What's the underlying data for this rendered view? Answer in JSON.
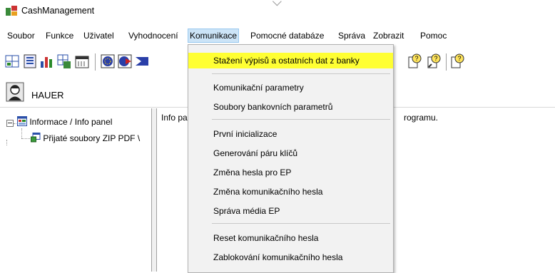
{
  "window": {
    "title": "CashManagement"
  },
  "menubar": {
    "items": [
      {
        "label": "Soubor"
      },
      {
        "label": "Funkce"
      },
      {
        "label": "Uživatel"
      },
      {
        "label": "Vyhodnocení"
      },
      {
        "label": "Komunikace"
      },
      {
        "label": "Pomocné databáze"
      },
      {
        "label": "Správa"
      },
      {
        "label": "Zobrazit"
      },
      {
        "label": "Pomoc"
      }
    ]
  },
  "user": {
    "name": "HAUER"
  },
  "tree": {
    "root": "Informace / Info panel",
    "child": "Přijaté soubory ZIP PDF \\"
  },
  "info_panel": {
    "left_fragment": "Info pa",
    "right_fragment": "rogramu."
  },
  "komunikace_menu": {
    "items": [
      {
        "label": "Stažení výpisů a ostatních dat z banky",
        "highlighted": true
      },
      {
        "label": "Komunikační parametry"
      },
      {
        "label": "Soubory bankovních parametrů"
      },
      {
        "label": "První inicializace"
      },
      {
        "label": "Generování páru klíčů"
      },
      {
        "label": "Změna hesla pro EP"
      },
      {
        "label": "Změna komunikačního hesla"
      },
      {
        "label": "Správa média EP"
      },
      {
        "label": "Reset komunikačního hesla"
      },
      {
        "label": "Zablokování komunikačního hesla"
      }
    ]
  },
  "colors": {
    "highlight": "#ffff33",
    "menu_active": "#cce4f7"
  }
}
